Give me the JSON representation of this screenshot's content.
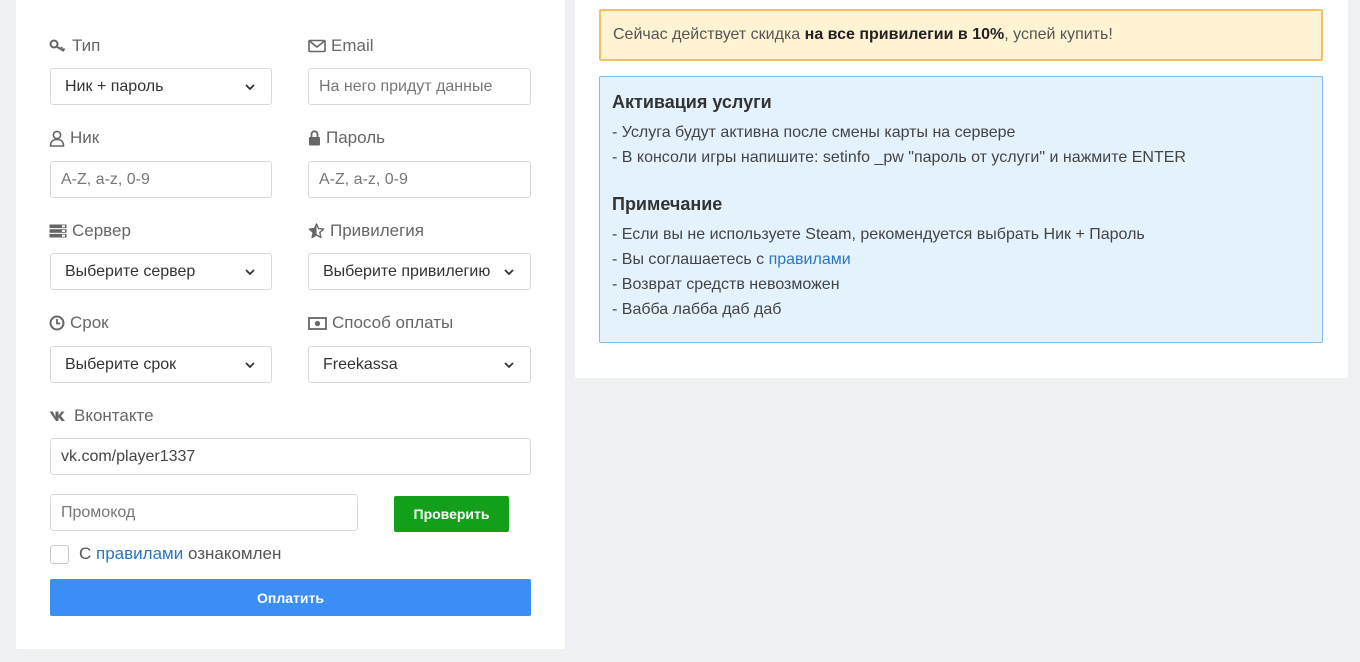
{
  "form": {
    "type": {
      "label": "Тип",
      "value": "Ник + пароль"
    },
    "email": {
      "label": "Email",
      "placeholder": "На него придут данные"
    },
    "nick": {
      "label": "Ник",
      "placeholder": "A-Z, a-z, 0-9"
    },
    "password": {
      "label": "Пароль",
      "placeholder": "A-Z, a-z, 0-9"
    },
    "server": {
      "label": "Сервер",
      "value": "Выберите сервер"
    },
    "privilege": {
      "label": "Привилегия",
      "value": "Выберите привилегию"
    },
    "term": {
      "label": "Срок",
      "value": "Выберите срок"
    },
    "payment": {
      "label": "Способ оплаты",
      "value": "Freekassa"
    },
    "vk": {
      "label": "Вконтакте",
      "value": "vk.com/player1337"
    },
    "promo": {
      "placeholder": "Промокод"
    },
    "check_button": "Проверить",
    "agree": {
      "prefix": "С",
      "link": "правилами",
      "suffix": "ознакомлен"
    },
    "pay_button": "Оплатить"
  },
  "discount": {
    "prefix": "Сейчас действует скидка",
    "bold": "на все привилегии в 10%",
    "suffix": ", успей купить!"
  },
  "info": {
    "activation_title": "Активация услуги",
    "activation_lines": [
      "- Услуга будут активна после смены карты на сервере",
      "- В консоли игры напишите: setinfo _pw \"пароль от услуги\" и нажмите ENTER"
    ],
    "note_title": "Примечание",
    "note_line1": "- Если вы не используете Steam, рекомендуется выбрать Ник + Пароль",
    "note_line2_prefix": "- Вы соглашаетесь с",
    "note_line2_link": "правилами",
    "note_line3": "- Возврат средств невозможен",
    "note_line4": "- Вабба лабба даб даб"
  },
  "colors": {
    "check_button": "#12a01a",
    "pay_button": "#3a8ef6",
    "link": "#2a76c6",
    "warning_bg": "#fff3d4",
    "info_bg": "#e4f2fd"
  }
}
